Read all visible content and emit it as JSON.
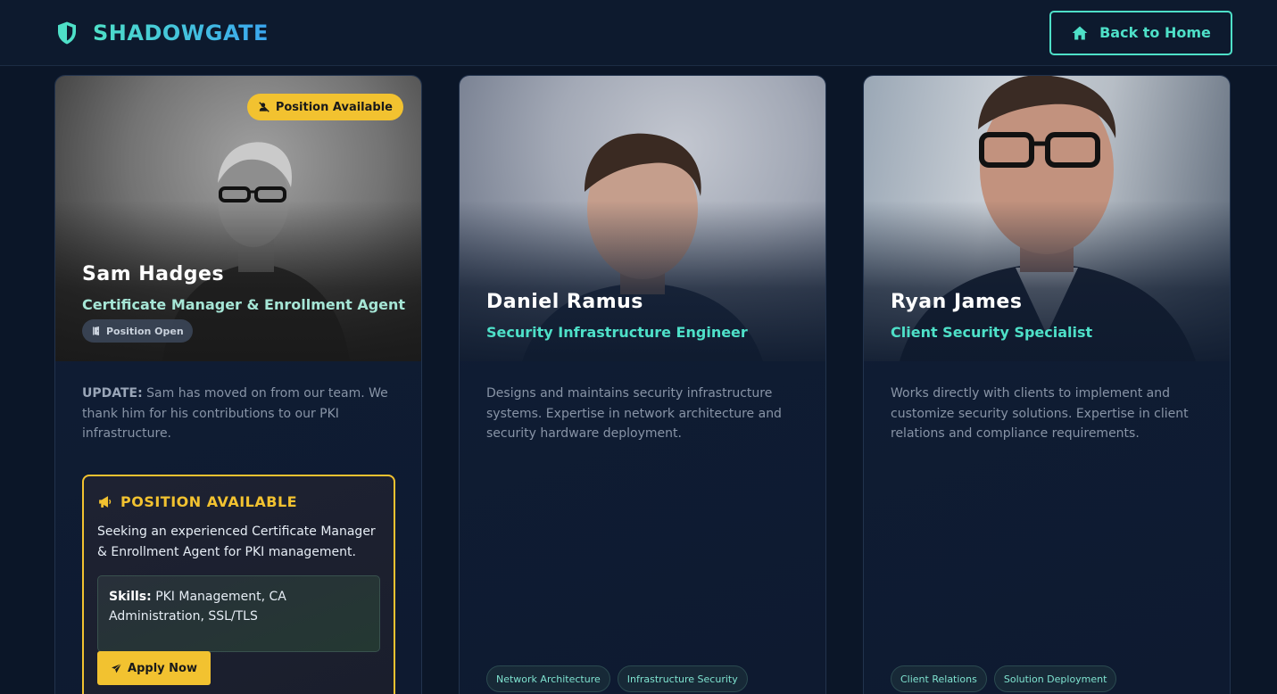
{
  "header": {
    "brand": "SHADOWGATE",
    "home_button": "Back to Home"
  },
  "colors": {
    "accent": "#4ee0c8",
    "warning": "#f2c230",
    "background": "#0b1628"
  },
  "cards": [
    {
      "name": "Sam Hadges",
      "role": "Certificate Manager & Enrollment Agent",
      "badge": "Position Available",
      "status_tag": "Position Open",
      "update_label": "UPDATE:",
      "description": "Sam has moved on from our team. We thank him for his contributions to our PKI infrastructure.",
      "position": {
        "title": "POSITION AVAILABLE",
        "text": "Seeking an experienced Certificate Manager & Enrollment Agent for PKI management.",
        "skills_label": "Skills:",
        "skills": "PKI Management, CA Administration, SSL/TLS",
        "apply_label": "Apply Now"
      }
    },
    {
      "name": "Daniel Ramus",
      "role": "Security Infrastructure Engineer",
      "description": "Designs and maintains security infrastructure systems. Expertise in network architecture and security hardware deployment.",
      "tags": [
        "Network Architecture",
        "Infrastructure Security"
      ]
    },
    {
      "name": "Ryan James",
      "role": "Client Security Specialist",
      "description": "Works directly with clients to implement and customize security solutions. Expertise in client relations and compliance requirements.",
      "tags": [
        "Client Relations",
        "Solution Deployment"
      ]
    }
  ],
  "icons": {
    "brand": "shield-icon",
    "home": "home-icon",
    "badge": "user-slash-icon",
    "status": "door-open-icon",
    "position": "megaphone-icon",
    "apply": "paper-plane-icon"
  }
}
